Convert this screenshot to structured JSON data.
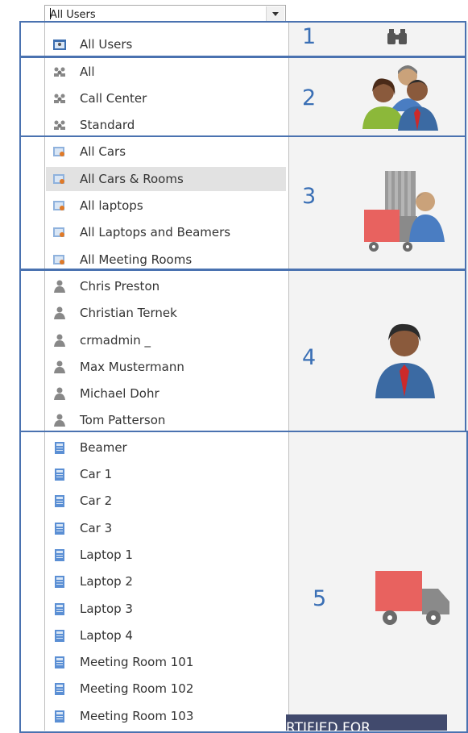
{
  "combo": {
    "value": "All Users"
  },
  "sections": {
    "s1": {
      "number": "1",
      "items": [
        {
          "label": "All Users",
          "selected": false
        }
      ]
    },
    "s2": {
      "number": "2",
      "items": [
        {
          "label": "All"
        },
        {
          "label": "Call Center"
        },
        {
          "label": "Standard"
        }
      ]
    },
    "s3": {
      "number": "3",
      "items": [
        {
          "label": "All Cars"
        },
        {
          "label": "All Cars & Rooms",
          "selected": true
        },
        {
          "label": "All laptops"
        },
        {
          "label": "All Laptops and Beamers"
        },
        {
          "label": "All Meeting Rooms"
        }
      ]
    },
    "s4": {
      "number": "4",
      "items": [
        {
          "label": "Chris Preston"
        },
        {
          "label": "Christian Ternek"
        },
        {
          "label": "crmadmin _"
        },
        {
          "label": "Max Mustermann"
        },
        {
          "label": "Michael Dohr"
        },
        {
          "label": "Tom Patterson"
        }
      ]
    },
    "s5": {
      "number": "5",
      "items": [
        {
          "label": "Beamer"
        },
        {
          "label": "Car 1"
        },
        {
          "label": "Car 2"
        },
        {
          "label": "Car 3"
        },
        {
          "label": "Laptop 1"
        },
        {
          "label": "Laptop 2"
        },
        {
          "label": "Laptop 3"
        },
        {
          "label": "Laptop 4"
        },
        {
          "label": "Meeting Room 101"
        },
        {
          "label": "Meeting Room 102"
        },
        {
          "label": "Meeting Room 103"
        }
      ]
    }
  },
  "banner": {
    "text": "RTIFIED FOR"
  },
  "icons": {
    "section1": "binoculars-icon",
    "section2": "user-group-icon",
    "section3": "resource-group-icon",
    "section4": "user-icon",
    "section5": "truck-icon"
  },
  "colors": {
    "section_border": "#4a72b0",
    "number": "#3a6fb5",
    "truck": "#e8625f",
    "banner": "#414a6d"
  }
}
